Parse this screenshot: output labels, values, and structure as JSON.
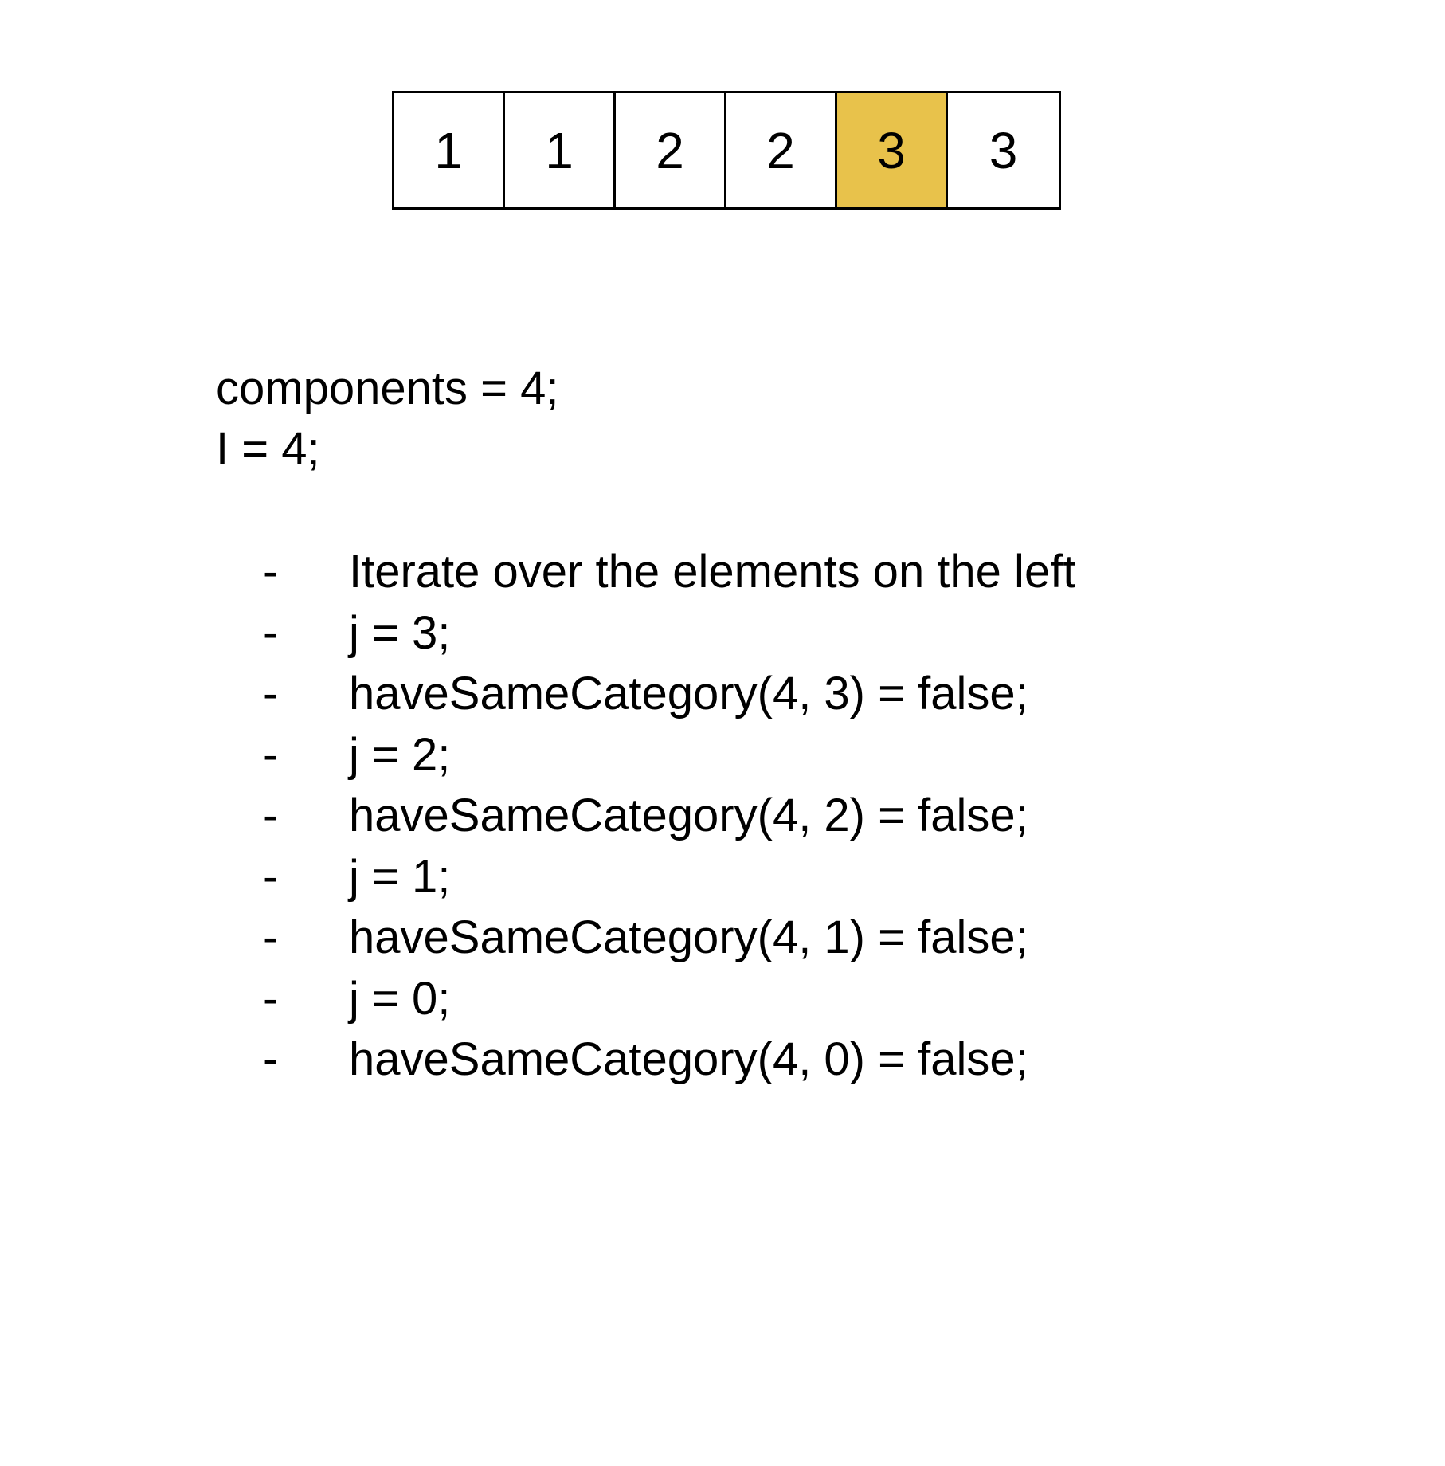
{
  "array": {
    "cells": [
      {
        "value": "1",
        "highlighted": false
      },
      {
        "value": "1",
        "highlighted": false
      },
      {
        "value": "2",
        "highlighted": false
      },
      {
        "value": "2",
        "highlighted": false
      },
      {
        "value": "3",
        "highlighted": true
      },
      {
        "value": "3",
        "highlighted": false
      }
    ],
    "highlight_color": "#E8C24B"
  },
  "vars": {
    "line1": "components = 4;",
    "line2": "I = 4;"
  },
  "steps": {
    "bullet": "-",
    "items": [
      "Iterate over the elements on the left",
      "j = 3;",
      "haveSameCategory(4, 3) = false;",
      "j = 2;",
      "haveSameCategory(4, 2) = false;",
      "j = 1;",
      "haveSameCategory(4, 1) = false;",
      "j = 0;",
      "haveSameCategory(4, 0) = false;"
    ]
  }
}
